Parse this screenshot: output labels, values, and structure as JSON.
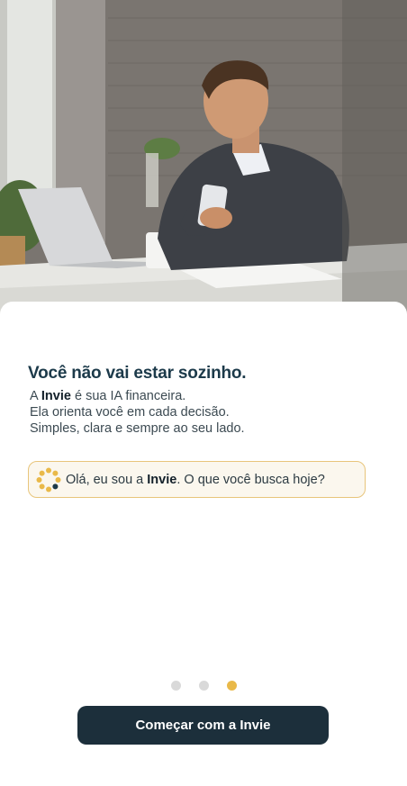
{
  "hero": {
    "image": "man-using-smartphone-at-desk-photo"
  },
  "onboarding": {
    "title": "Você não vai estar sozinho.",
    "line1_prefix": "A ",
    "line1_brand": "Invie",
    "line1_suffix": " é sua IA financeira.",
    "line2": "Ela orienta você em cada decisão.",
    "line3": "Simples, clara e sempre ao seu lado."
  },
  "chat_prompt": {
    "icon": "invie-logo-icon",
    "prefix": "Olá, eu sou a ",
    "brand": "Invie",
    "suffix": ". O que você busca hoje?"
  },
  "pagination": {
    "total": 3,
    "active_index": 3
  },
  "cta": {
    "label": "Começar com a Invie"
  },
  "colors": {
    "primary": "#1c2f3b",
    "title": "#1c3a4a",
    "accent": "#e9b949",
    "chat_border": "#e8c57b",
    "dot_inactive": "#d9d9d9"
  }
}
